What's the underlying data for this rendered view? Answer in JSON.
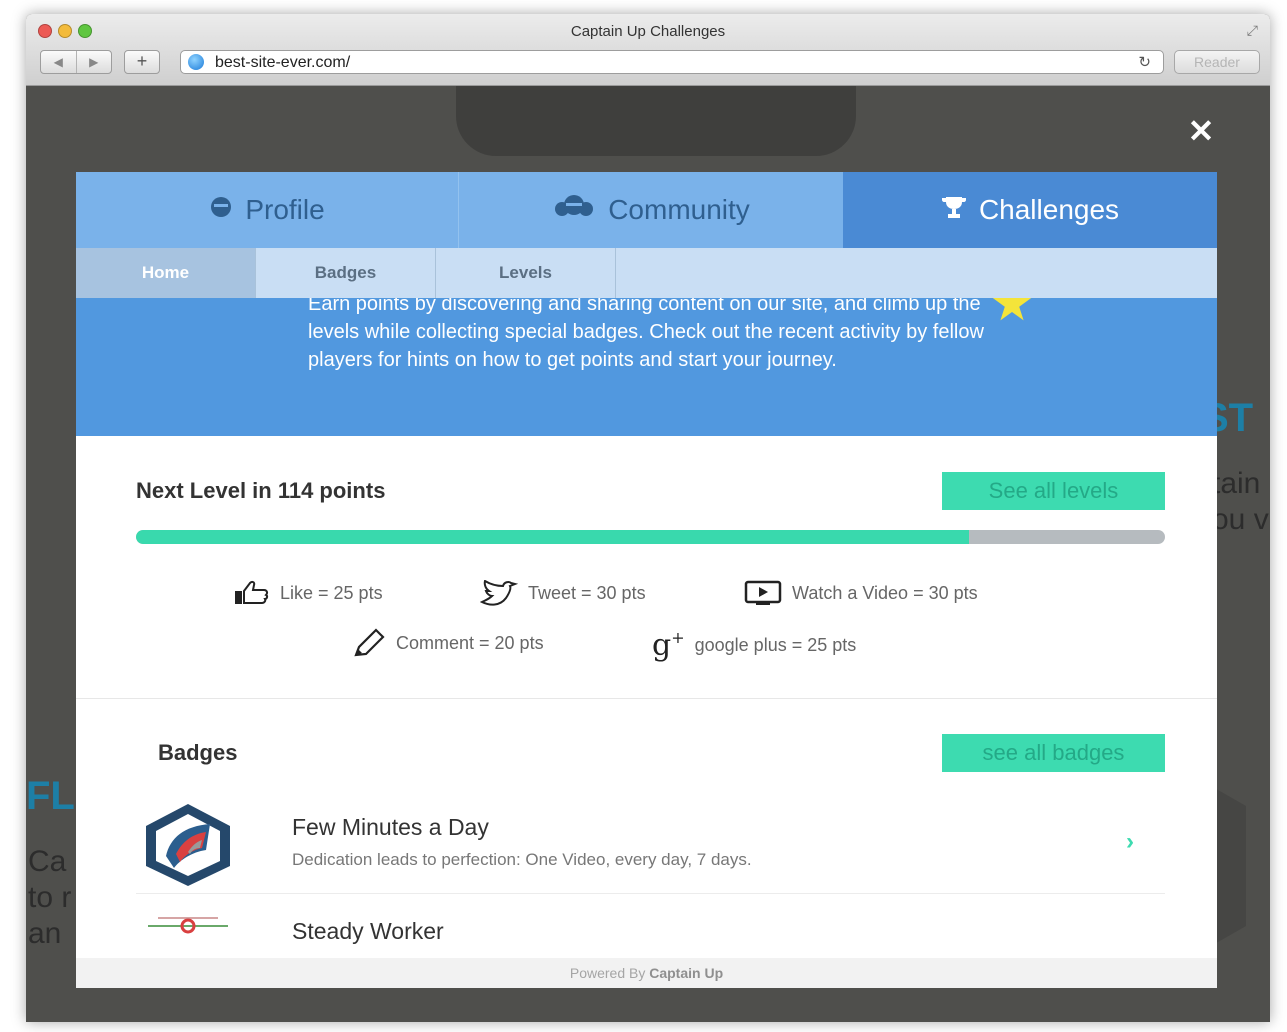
{
  "browser": {
    "title": "Captain Up Challenges",
    "url": "best-site-ever.com/",
    "reader_label": "Reader",
    "back_label": "◀",
    "forward_label": "▶",
    "new_tab_label": "+",
    "reload_label": "↻",
    "fullscreen_label": "⤢"
  },
  "background_page": {
    "heading_right": "ST",
    "text_right": "tain\nou v",
    "heading_left": "FL",
    "text_left": "Ca\nto r\nan"
  },
  "overlay": {
    "close_label": "✕"
  },
  "main_tabs": [
    {
      "label": "Profile",
      "icon": "profile-icon",
      "active": false
    },
    {
      "label": "Community",
      "icon": "community-icon",
      "active": false
    },
    {
      "label": "Challenges",
      "icon": "trophy-icon",
      "active": true
    }
  ],
  "sub_tabs": [
    {
      "label": "Home",
      "active": true
    },
    {
      "label": "Badges",
      "active": false
    },
    {
      "label": "Levels",
      "active": false
    }
  ],
  "intro": {
    "text": "Earn points by discovering and sharing content on our site, and climb up the levels while collecting special badges. Check out the recent activity by fellow players for hints on how to get points and start your journey."
  },
  "level": {
    "title": "Next Level in 114 points",
    "button_label": "See all levels",
    "progress_percent": 81
  },
  "actions": [
    {
      "label": "Like = 25 pts",
      "icon": "thumbs-up-icon"
    },
    {
      "label": "Tweet = 30 pts",
      "icon": "twitter-bird-icon"
    },
    {
      "label": "Watch a Video = 30 pts",
      "icon": "video-play-icon"
    },
    {
      "label": "Comment = 20 pts",
      "icon": "pencil-icon"
    },
    {
      "label": "google plus = 25 pts",
      "icon": "google-plus-icon"
    }
  ],
  "badges": {
    "title": "Badges",
    "button_label": "see all badges",
    "items": [
      {
        "name": "Few Minutes a Day",
        "description": "Dedication leads to perfection: One Video, every day, 7 days."
      },
      {
        "name": "Steady Worker",
        "description": ""
      }
    ]
  },
  "footer": {
    "prefix": "Powered By ",
    "brand": "Captain Up"
  },
  "colors": {
    "accent_teal": "#3ddbb0",
    "tab_blue": "#7ab2ea",
    "active_tab_blue": "#4a8ad4",
    "intro_blue": "#5198df"
  }
}
